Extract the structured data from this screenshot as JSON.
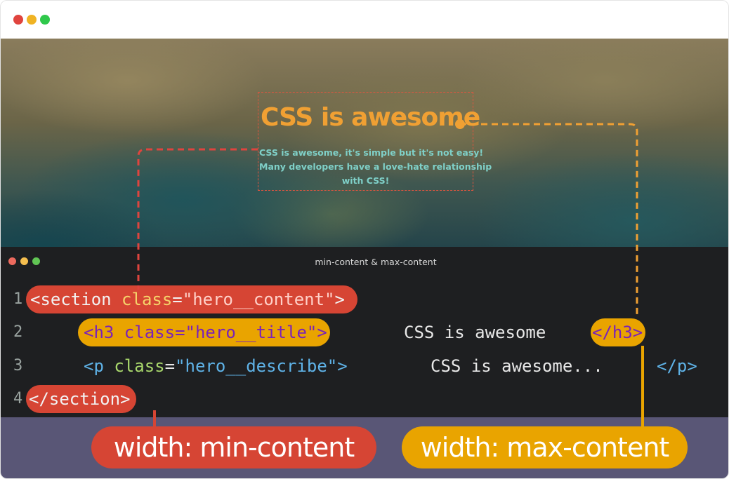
{
  "window": {
    "dots": [
      "#e0443e",
      "#f0b323",
      "#2fc84b"
    ]
  },
  "hero": {
    "title": "CSS is awesome",
    "description_lines": [
      "CSS is awesome, it's simple but it's not easy!",
      "Many developers have a love-hate relationship",
      "with CSS!"
    ],
    "colors": {
      "title": "#f0a033",
      "description": "#7fd0c8",
      "outline": "#e0553f"
    }
  },
  "editor": {
    "title": "min-content & max-content",
    "dots": [
      "#ed6a5e",
      "#f5be4f",
      "#61c554"
    ],
    "lines": [
      {
        "number": "1",
        "open": "<section",
        "attr": " class",
        "eq": "=",
        "value": "\"hero__content\"",
        "close": ">"
      },
      {
        "number": "2",
        "open": "<h3",
        "attr": " class",
        "eq": "=",
        "value": "\"hero__title\"",
        "close": ">",
        "text": "CSS is awesome",
        "end_tag": "</h3>"
      },
      {
        "number": "3",
        "open": "<p",
        "attr": " class",
        "eq": "=",
        "value": "\"hero__describe\"",
        "close": ">",
        "text": "CSS is awesome...",
        "end_tag": "</p>"
      },
      {
        "number": "4",
        "end_tag": "</section>"
      }
    ]
  },
  "labels": {
    "min": "width: min-content",
    "max": "width: max-content",
    "colors": {
      "min": "#d64534",
      "max": "#e9a400",
      "background": "#595676"
    }
  }
}
